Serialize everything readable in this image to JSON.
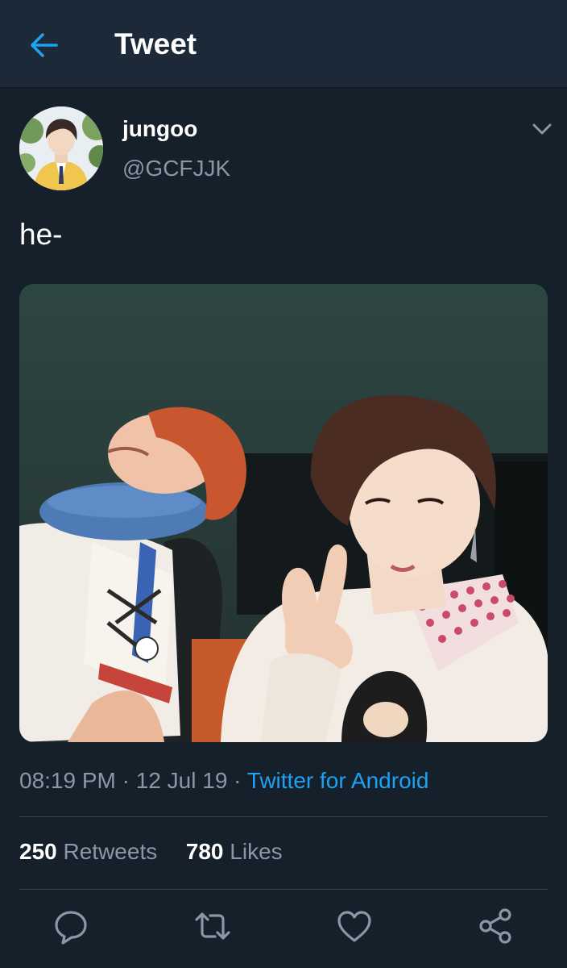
{
  "header": {
    "title": "Tweet",
    "back_icon": "arrow-left-icon",
    "accent": "#1da1f2"
  },
  "tweet": {
    "author": {
      "display_name": "jungoo",
      "handle": "@GCFJJK"
    },
    "text": "he-",
    "time": "08:19 PM",
    "date": "12 Jul 19",
    "source": "Twitter for Android",
    "separator": " · "
  },
  "stats": {
    "retweets_count": "250",
    "retweets_label": "Retweets",
    "likes_count": "780",
    "likes_label": "Likes"
  },
  "actions": [
    "reply-icon",
    "retweet-icon",
    "like-icon",
    "share-icon"
  ],
  "colors": {
    "background": "#15202b",
    "header": "#1c2938",
    "secondary_text": "#8899a6",
    "link": "#1da1f2"
  }
}
